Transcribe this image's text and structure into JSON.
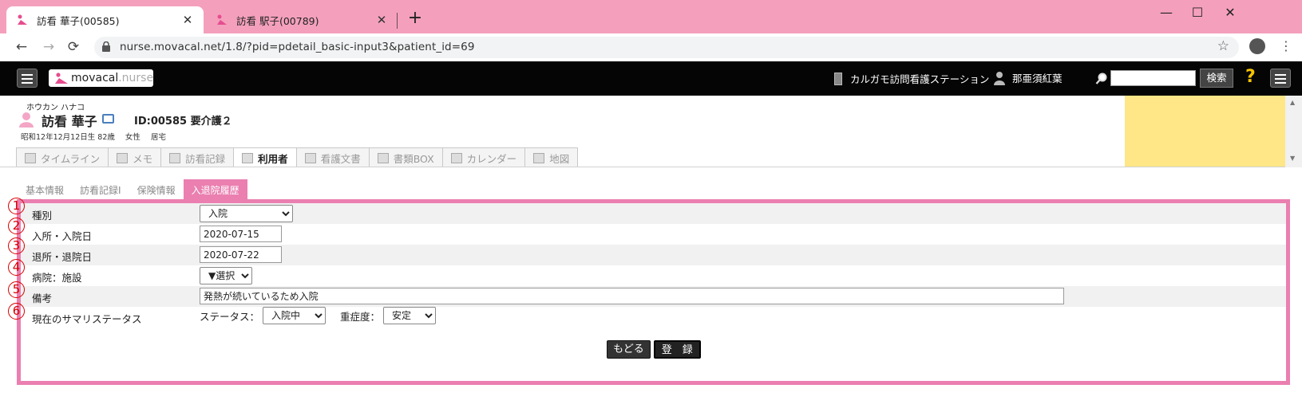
{
  "browser": {
    "tabs": [
      {
        "title": "訪看 華子(00585)",
        "active": true
      },
      {
        "title": "訪看 駅子(00789)",
        "active": false
      }
    ],
    "url": "nurse.movacal.net/1.8/?pid=pdetail_basic-input3&patient_id=69",
    "icons": {
      "back": "←",
      "forward": "→",
      "reload": "⟳",
      "star": "☆",
      "new_tab": "+",
      "close": "✕",
      "minimize": "—",
      "maximize": "☐",
      "win_close": "✕",
      "kebab": "⋮"
    }
  },
  "app": {
    "logo_brand": "movacal",
    "logo_sub": ".nurse",
    "station": "カルガモ訪問看護ステーション",
    "user": "那亜須紅葉",
    "search_button": "検索",
    "help": "?"
  },
  "patient": {
    "kana": "ホウカン ハナコ",
    "name": "訪看 華子",
    "id_care": "ID:00585 要介護２",
    "birth": "昭和12年12月12日生 82歳",
    "gender": "女性",
    "residence": "居宅"
  },
  "nav_tabs": [
    "タイムライン",
    "メモ",
    "訪看記録",
    "利用者",
    "看護文書",
    "書類BOX",
    "カレンダー",
    "地図"
  ],
  "sub_tabs": [
    "基本情報",
    "訪看記録I",
    "保険情報",
    "入退院履歴"
  ],
  "form": {
    "markers": [
      "1",
      "2",
      "3",
      "4",
      "5",
      "6"
    ],
    "rows": [
      {
        "label": "種別",
        "value": "入院"
      },
      {
        "label": "入所・入院日",
        "value": "2020-07-15"
      },
      {
        "label": "退所・退院日",
        "value": "2020-07-22"
      },
      {
        "label": "病院：施設",
        "value": "▼選択"
      },
      {
        "label": "備考",
        "value": "発熱が続いているため入院"
      },
      {
        "label": "現在のサマリステータス"
      }
    ],
    "status_label": "ステータス：",
    "status_value": "入院中",
    "severity_label": "重症度：",
    "severity_value": "安定",
    "back_button": "もどる",
    "submit_button": "登　録"
  },
  "colors": {
    "tabstrip": "#f4a0bd",
    "accent": "#ea7fb0",
    "appbar": "#050505",
    "yellow_panel": "#ffe686",
    "marker": "#d80000"
  }
}
